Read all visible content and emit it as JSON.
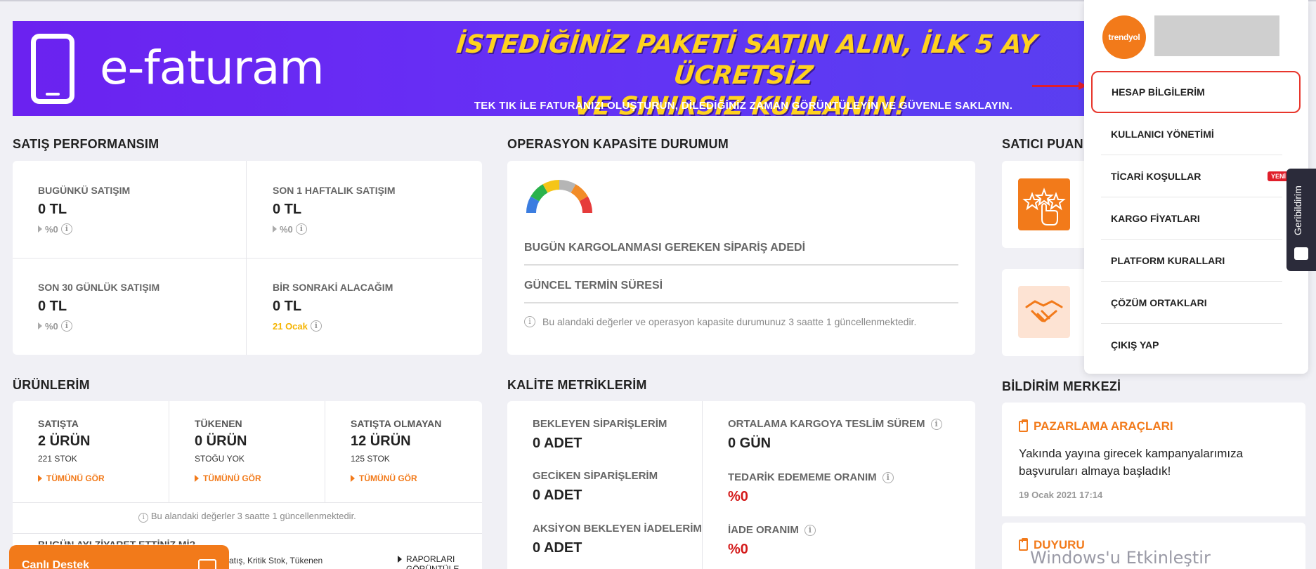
{
  "banner": {
    "logo": "e-faturam",
    "headline_1": "İSTEDİĞİNİZ PAKETİ SATIN ALIN, İLK 5 AY ÜCRETSİZ",
    "headline_2": "VE SINIRSIZ KULLANIN!",
    "subline": "TEK TIK İLE FATURANIZI OLUŞTURUN, DİLEDİĞİNİZ ZAMAN GÖRÜNTÜLEYİN VE GÜVENLE SAKLAYIN."
  },
  "sales": {
    "title": "SATIŞ PERFORMANSIM",
    "items": [
      {
        "label": "BUGÜNKÜ SATIŞIM",
        "value": "0 TL",
        "pct": "%0"
      },
      {
        "label": "SON 1 HAFTALIK SATIŞIM",
        "value": "0 TL",
        "pct": "%0"
      },
      {
        "label": "SON 30 GÜNLÜK SATIŞIM",
        "value": "0 TL",
        "pct": "%0"
      },
      {
        "label": "BİR SONRAKİ ALACAĞIM",
        "value": "0 TL",
        "pct": "21 Ocak"
      }
    ]
  },
  "capacity": {
    "title": "OPERASYON KAPASİTE DURUMUM",
    "row1": "BUGÜN KARGOLANMASI GEREKEN SİPARİŞ ADEDİ",
    "row2": "GÜNCEL TERMİN SÜRESİ",
    "note": "Bu alandaki değerler ve operasyon kapasite durumunuz 3 saatte 1 güncellenmektedir.",
    "gauge_colors": [
      "#3b7de0",
      "#2bb24c",
      "#f5c518",
      "#b5b5b5",
      "#f28c28",
      "#e63b3b"
    ]
  },
  "seller_score": {
    "title": "SATICI PUAN"
  },
  "products": {
    "title": "ÜRÜNLERİM",
    "items": [
      {
        "label": "SATIŞTA",
        "value": "2 ÜRÜN",
        "sub": "221 STOK",
        "link": "TÜMÜNÜ GÖR"
      },
      {
        "label": "TÜKENEN",
        "value": "0 ÜRÜN",
        "sub": "STOĞU YOK",
        "link": "TÜMÜNÜ GÖR"
      },
      {
        "label": "SATIŞTA OLMAYAN",
        "value": "12 ÜRÜN",
        "sub": "125 STOK",
        "link": "TÜMÜNÜ GÖR"
      }
    ],
    "note": "Bu alandaki değerler 3 saatte 1 güncellenmektedir.",
    "bottom_title": "BUGÜN AYI ZİYARET ETTİNİZ Mİ?",
    "bottom_text": "Satış, Kritik Stok, Tükenen",
    "reports_link": "RAPORLARI GÖRÜNTÜLE"
  },
  "quality": {
    "title": "KALİTE METRİKLERİM",
    "left": [
      {
        "label": "BEKLEYEN SİPARİŞLERİM",
        "value": "0 ADET"
      },
      {
        "label": "GECİKEN SİPARİŞLERİM",
        "value": "0 ADET"
      },
      {
        "label": "AKSİYON BEKLEYEN İADELERİM",
        "value": "0 ADET"
      }
    ],
    "right": [
      {
        "label": "ORTALAMA KARGOYA TESLİM SÜREM",
        "value": "0 GÜN"
      },
      {
        "label": "TEDARİK EDEMEME ORANIM",
        "value": "%0"
      },
      {
        "label": "İADE ORANIM",
        "value": "%0"
      }
    ]
  },
  "notifications": {
    "title": "BİLDİRİM MERKEZİ",
    "items": [
      {
        "category": "PAZARLAMA ARAÇLARI",
        "text": "Yakında yayına girecek kampanyalarımıza başvuruları almaya başladık!",
        "date": "19 Ocak 2021 17:14"
      },
      {
        "category": "DUYURU"
      }
    ]
  },
  "dropdown": {
    "avatar_text": "trendyol",
    "items": [
      {
        "label": "HESAP BİLGİLERİM"
      },
      {
        "label": "KULLANICI YÖNETİMİ"
      },
      {
        "label": "TİCARİ KOŞULLAR",
        "badge": "YENİ"
      },
      {
        "label": "KARGO FİYATLARI"
      },
      {
        "label": "PLATFORM KURALLARI"
      },
      {
        "label": "ÇÖZÜM ORTAKLARI"
      },
      {
        "label": "ÇIKIŞ YAP"
      }
    ]
  },
  "feedback": "Geribildirim",
  "live_support": "Canlı Destek",
  "watermark": "Windows'u Etkinleştir",
  "colors": {
    "accent": "#f27a1a",
    "danger": "#e01e2a",
    "banner": "#6b22f0"
  }
}
